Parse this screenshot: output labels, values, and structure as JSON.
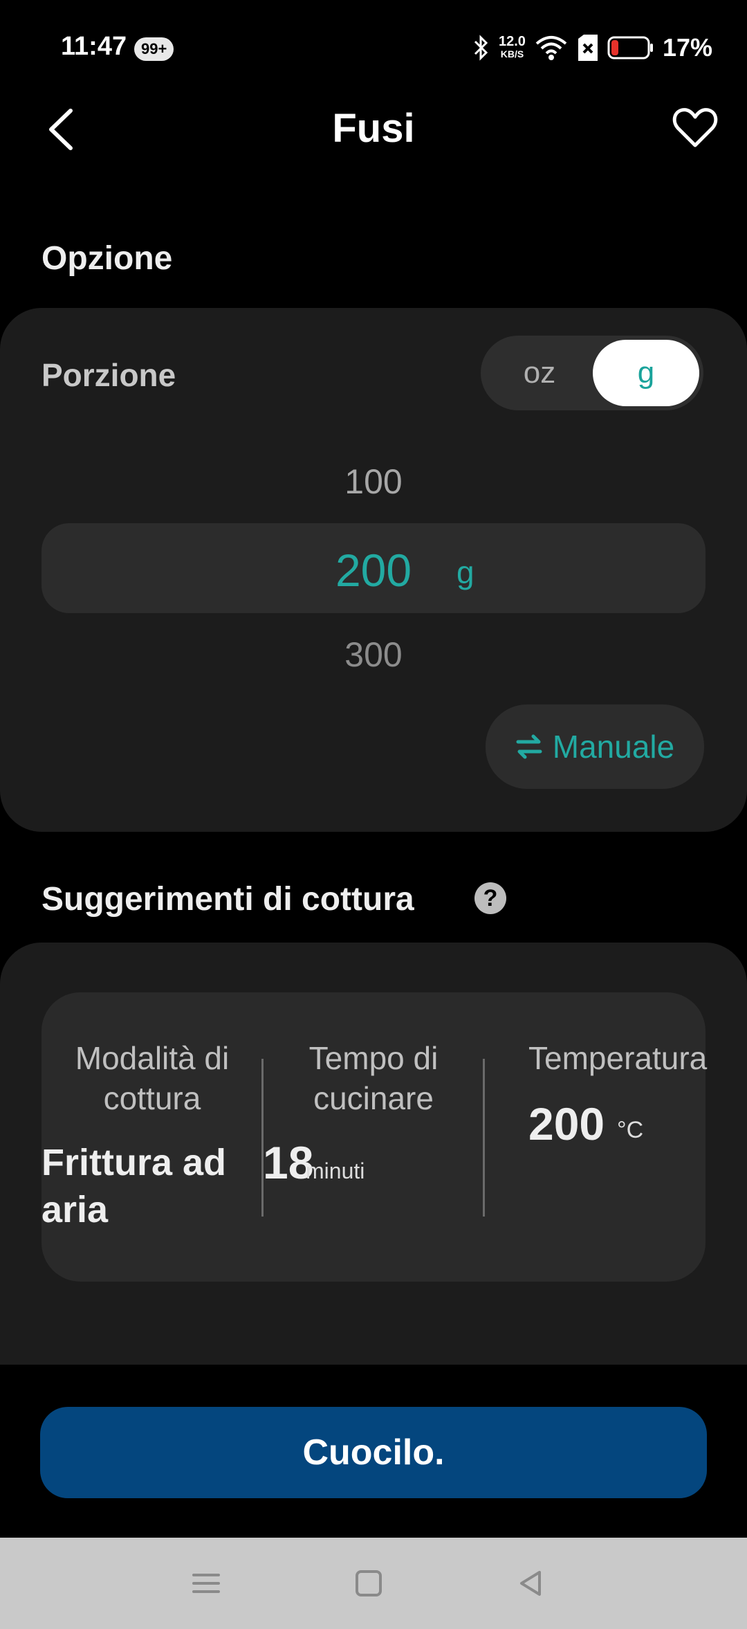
{
  "status_bar": {
    "time": "11:47",
    "notification_badge": "99+",
    "net_speed": "12.0",
    "net_speed_unit": "KB/S",
    "battery": "17%"
  },
  "header": {
    "title": "Fusi"
  },
  "options": {
    "section_title": "Opzione",
    "portion_label": "Porzione",
    "unit_options": [
      "oz",
      "g"
    ],
    "selected_unit": "g",
    "picker": {
      "prev": "100",
      "selected": "200",
      "next": "300",
      "unit": "g"
    },
    "manual_label": "Manuale"
  },
  "suggestions": {
    "section_title": "Suggerimenti di cottura",
    "help_glyph": "?",
    "mode_label": "Modalità di cottura",
    "mode_value": "Frittura ad aria",
    "time_label": "Tempo di cucinare",
    "time_value": "18",
    "time_unit": "minuti",
    "temp_label": "Temperatura",
    "temp_value": "200",
    "temp_unit": "°C"
  },
  "primary_button": "Cuocilo.",
  "colors": {
    "accent": "#22aaa2",
    "primary_button": "#04467e",
    "card_bg": "#1c1c1c"
  }
}
